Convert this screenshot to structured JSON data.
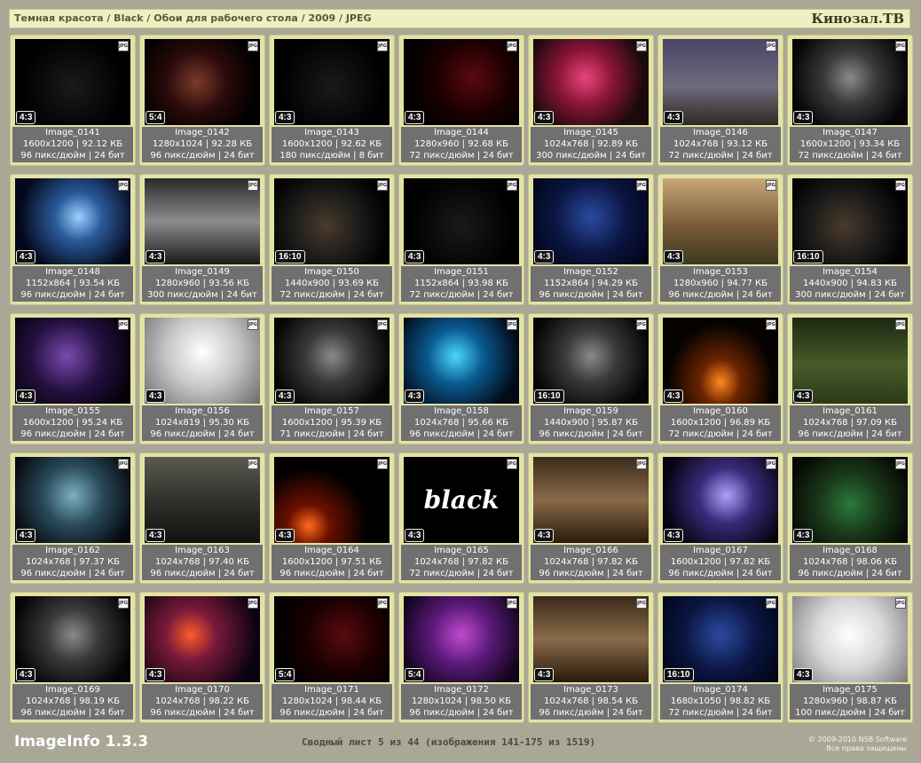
{
  "header": {
    "breadcrumb": "Темная красота / Black / Обои для рабочего стола / 2009 / JPEG",
    "site_name": "Кинозал.ТВ"
  },
  "colors": {
    "background": "#a9a796",
    "tile": "#e3e3a5",
    "info_panel": "#707070"
  },
  "tiles": [
    {
      "name": "Image_0141",
      "ratio": "4:3",
      "meta1": "1600x1200 | 92.12 КБ",
      "meta2": "96 пикс/дюйм | 24 бит",
      "art": "black"
    },
    {
      "name": "Image_0142",
      "ratio": "5:4",
      "meta1": "1280x1024 | 92.28 КБ",
      "meta2": "96 пикс/дюйм | 24 бит",
      "art": "maroon"
    },
    {
      "name": "Image_0143",
      "ratio": "4:3",
      "meta1": "1600x1200 | 92.62 КБ",
      "meta2": "180 пикс/дюйм | 8 бит",
      "art": "black"
    },
    {
      "name": "Image_0144",
      "ratio": "4:3",
      "meta1": "1280x960 | 92.68 КБ",
      "meta2": "72 пикс/дюйм | 24 бит",
      "art": "darkred"
    },
    {
      "name": "Image_0145",
      "ratio": "4:3",
      "meta1": "1024x768 | 92.89 КБ",
      "meta2": "300 пикс/дюйм | 24 бит",
      "art": "pink"
    },
    {
      "name": "Image_0146",
      "ratio": "4:3",
      "meta1": "1024x768 | 93.12 КБ",
      "meta2": "72 пикс/дюйм | 24 бит",
      "art": "castle"
    },
    {
      "name": "Image_0147",
      "ratio": "4:3",
      "meta1": "1600x1200 | 93.34 КБ",
      "meta2": "72 пикс/дюйм | 24 бит",
      "art": "grey"
    },
    {
      "name": "Image_0148",
      "ratio": "4:3",
      "meta1": "1152x864 | 93.54 КБ",
      "meta2": "96 пикс/дюйм | 24 бит",
      "art": "blue"
    },
    {
      "name": "Image_0149",
      "ratio": "4:3",
      "meta1": "1280x960 | 93.56 КБ",
      "meta2": "300 пикс/дюйм | 24 бит",
      "art": "car"
    },
    {
      "name": "Image_0150",
      "ratio": "16:10",
      "meta1": "1440x900 | 93.69 КБ",
      "meta2": "72 пикс/дюйм | 24 бит",
      "art": "panther"
    },
    {
      "name": "Image_0151",
      "ratio": "4:3",
      "meta1": "1152x864 | 93.98 КБ",
      "meta2": "72 пикс/дюйм | 24 бит",
      "art": "black"
    },
    {
      "name": "Image_0152",
      "ratio": "4:3",
      "meta1": "1152x864 | 94.29 КБ",
      "meta2": "96 пикс/дюйм | 24 бит",
      "art": "navy"
    },
    {
      "name": "Image_0153",
      "ratio": "4:3",
      "meta1": "1280x960 | 94.77 КБ",
      "meta2": "96 пикс/дюйм | 24 бит",
      "art": "portrait"
    },
    {
      "name": "Image_0154",
      "ratio": "16:10",
      "meta1": "1440x900 | 94.83 КБ",
      "meta2": "300 пикс/дюйм | 24 бит",
      "art": "panther"
    },
    {
      "name": "Image_0155",
      "ratio": "4:3",
      "meta1": "1600x1200 | 95.24 КБ",
      "meta2": "96 пикс/дюйм | 24 бит",
      "art": "purple"
    },
    {
      "name": "Image_0156",
      "ratio": "4:3",
      "meta1": "1024x819 | 95.30 КБ",
      "meta2": "96 пикс/дюйм | 24 бит",
      "art": "white"
    },
    {
      "name": "Image_0157",
      "ratio": "4:3",
      "meta1": "1600x1200 | 95.39 КБ",
      "meta2": "71 пикс/дюйм | 24 бит",
      "art": "grey"
    },
    {
      "name": "Image_0158",
      "ratio": "4:3",
      "meta1": "1024x768 | 95.66 КБ",
      "meta2": "96 пикс/дюйм | 24 бит",
      "art": "cyan"
    },
    {
      "name": "Image_0159",
      "ratio": "16:10",
      "meta1": "1440x900 | 95.87 КБ",
      "meta2": "96 пикс/дюйм | 24 бит",
      "art": "grey"
    },
    {
      "name": "Image_0160",
      "ratio": "4:3",
      "meta1": "1600x1200 | 96.89 КБ",
      "meta2": "72 пикс/дюйм | 24 бит",
      "art": "pumpkin"
    },
    {
      "name": "Image_0161",
      "ratio": "4:3",
      "meta1": "1024x768 | 97.09 КБ",
      "meta2": "96 пикс/дюйм | 24 бит",
      "art": "dog"
    },
    {
      "name": "Image_0162",
      "ratio": "4:3",
      "meta1": "1024x768 | 97.37 КБ",
      "meta2": "96 пикс/дюйм | 24 бит",
      "art": "teal"
    },
    {
      "name": "Image_0163",
      "ratio": "4:3",
      "meta1": "1024x768 | 97.40 КБ",
      "meta2": "96 пикс/дюйм | 24 бит",
      "art": "heron"
    },
    {
      "name": "Image_0164",
      "ratio": "4:3",
      "meta1": "1600x1200 | 97.51 КБ",
      "meta2": "96 пикс/дюйм | 24 бит",
      "art": "fire"
    },
    {
      "name": "Image_0165",
      "ratio": "4:3",
      "meta1": "1024x768 | 97.82 КБ",
      "meta2": "72 пикс/дюйм | 24 бит",
      "art": "blacktext"
    },
    {
      "name": "Image_0166",
      "ratio": "4:3",
      "meta1": "1024x768 | 97.82 КБ",
      "meta2": "96 пикс/дюйм | 24 бит",
      "art": "cats"
    },
    {
      "name": "Image_0167",
      "ratio": "4:3",
      "meta1": "1600x1200 | 97.82 КБ",
      "meta2": "96 пикс/дюйм | 24 бит",
      "art": "violet"
    },
    {
      "name": "Image_0168",
      "ratio": "4:3",
      "meta1": "1024x768 | 98.06 КБ",
      "meta2": "96 пикс/дюйм | 24 бит",
      "art": "frog"
    },
    {
      "name": "Image_0169",
      "ratio": "4:3",
      "meta1": "1024x768 | 98.19 КБ",
      "meta2": "96 пикс/дюйм | 24 бит",
      "art": "grey"
    },
    {
      "name": "Image_0170",
      "ratio": "4:3",
      "meta1": "1024x768 | 98.22 КБ",
      "meta2": "96 пикс/дюйм | 24 бит",
      "art": "fish"
    },
    {
      "name": "Image_0171",
      "ratio": "5:4",
      "meta1": "1280x1024 | 98.44 КБ",
      "meta2": "96 пикс/дюйм | 24 бит",
      "art": "darkred"
    },
    {
      "name": "Image_0172",
      "ratio": "5:4",
      "meta1": "1280x1024 | 98.50 КБ",
      "meta2": "96 пикс/дюйм | 24 бит",
      "art": "magenta"
    },
    {
      "name": "Image_0173",
      "ratio": "4:3",
      "meta1": "1024x768 | 98.54 КБ",
      "meta2": "96 пикс/дюйм | 24 бит",
      "art": "cats"
    },
    {
      "name": "Image_0174",
      "ratio": "16:10",
      "meta1": "1680x1050 | 98.82 КБ",
      "meta2": "72 пикс/дюйм | 24 бит",
      "art": "navy"
    },
    {
      "name": "Image_0175",
      "ratio": "4:3",
      "meta1": "1280x960 | 98.87 КБ",
      "meta2": "100 пикс/дюйм | 24 бит",
      "art": "angel"
    }
  ],
  "footer": {
    "app_name": "ImageInfo 1.3.3",
    "sheet_info": "Сводный лист 5 из 44 (изображения 141-175 из 1519)",
    "copyright_line1": "© 2009-2010 NSB Software",
    "copyright_line2": "Все права защищены"
  }
}
